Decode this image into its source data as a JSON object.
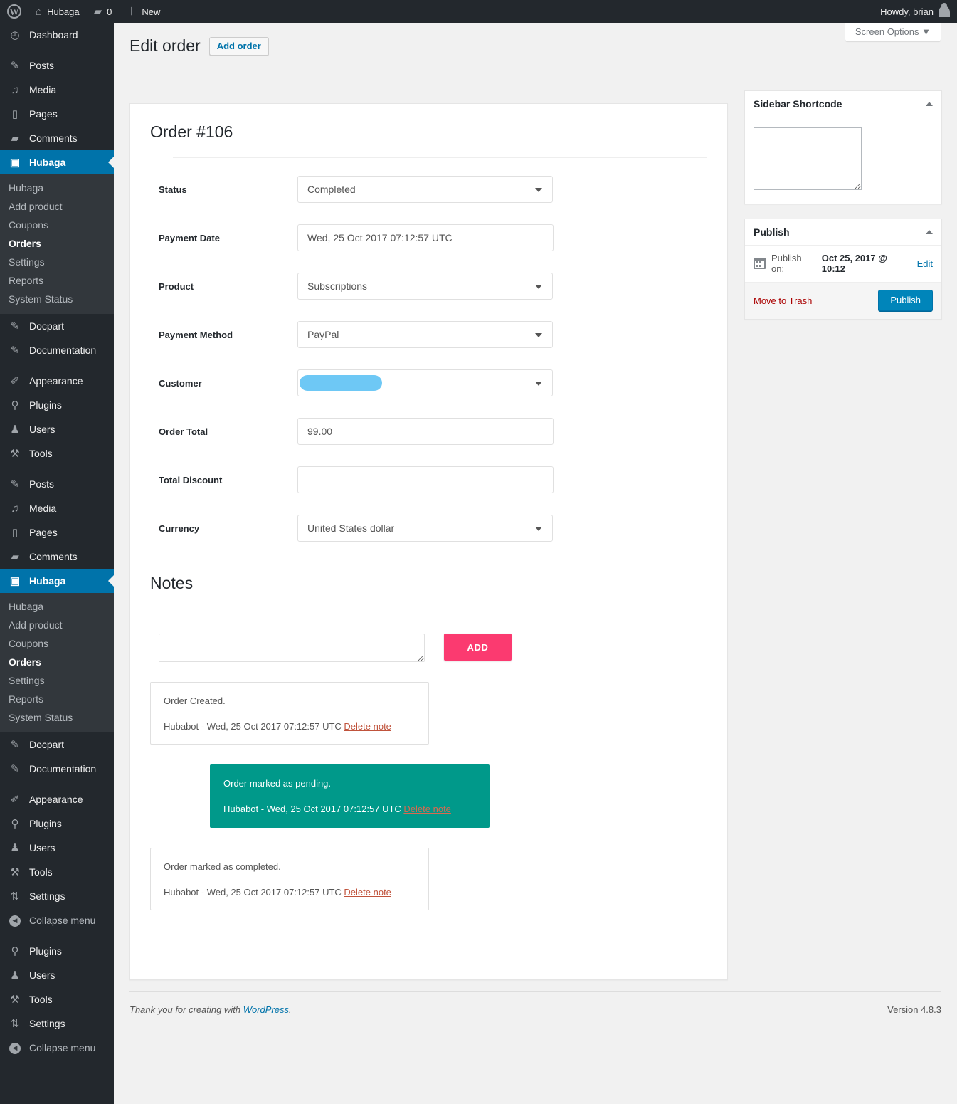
{
  "adminbar": {
    "logo_icon": "wordpress-logo",
    "site_name": "Hubaga",
    "site_icon": "home-icon",
    "comments_icon": "comment-bubble-icon",
    "comment_count": "0",
    "new_icon": "plus-icon",
    "new_label": "New",
    "howdy": "Howdy, brian",
    "avatar_icon": "user-avatar-icon"
  },
  "screen_meta": {
    "screen_options_label": "Screen Options",
    "caret_icon": "chevron-down-icon"
  },
  "header": {
    "title": "Edit order",
    "action_label": "Add order"
  },
  "sidebar": {
    "groups": [
      {
        "items": [
          {
            "label": "Dashboard",
            "icon": "dashboard-icon",
            "glyph": "◴",
            "current": false
          }
        ]
      },
      {
        "items": [
          {
            "label": "Posts",
            "icon": "pin-icon",
            "glyph": "✎",
            "current": false
          },
          {
            "label": "Media",
            "icon": "media-icon",
            "glyph": "♪",
            "current": false
          },
          {
            "label": "Pages",
            "icon": "page-icon",
            "glyph": "▮",
            "current": false
          },
          {
            "label": "Comments",
            "icon": "comment-bubble-icon",
            "glyph": "❝",
            "current": false
          },
          {
            "label": "Hubaga",
            "icon": "shopping-bag-icon",
            "glyph": "▢",
            "current": true
          }
        ]
      }
    ],
    "submenu": {
      "items": [
        {
          "label": "Hubaga",
          "current": false
        },
        {
          "label": "Add product",
          "current": false
        },
        {
          "label": "Coupons",
          "current": false
        },
        {
          "label": "Orders",
          "current": true
        },
        {
          "label": "Settings",
          "current": false
        },
        {
          "label": "Reports",
          "current": false
        },
        {
          "label": "System Status",
          "current": false
        }
      ]
    },
    "group_plugins": [
      {
        "label": "Docpart",
        "icon": "pin-icon",
        "glyph": "✎"
      },
      {
        "label": "Documentation",
        "icon": "pin-icon",
        "glyph": "✎"
      }
    ],
    "group_admin": [
      {
        "label": "Appearance",
        "icon": "paintbrush-icon",
        "glyph": "✐"
      },
      {
        "label": "Plugins",
        "icon": "plug-icon",
        "glyph": "⚯"
      },
      {
        "label": "Users",
        "icon": "user-icon",
        "glyph": "♟"
      },
      {
        "label": "Tools",
        "icon": "wrench-icon",
        "glyph": "⚒"
      }
    ],
    "group_admin_tail": [
      {
        "label": "Settings",
        "icon": "settings-sliders-icon",
        "glyph": "⇅"
      }
    ],
    "collapse_label": "Collapse menu",
    "collapse_icon": "collapse-arrow-icon"
  },
  "order": {
    "heading": "Order #106",
    "fields": [
      {
        "label": "Status",
        "type": "select",
        "value": "Completed",
        "name": "status"
      },
      {
        "label": "Payment Date",
        "type": "text",
        "value": "Wed, 25 Oct 2017 07:12:57 UTC",
        "name": "payment-date"
      },
      {
        "label": "Product",
        "type": "select",
        "value": "Subscriptions",
        "name": "product"
      },
      {
        "label": "Payment Method",
        "type": "select",
        "value": "PayPal",
        "name": "payment-method"
      },
      {
        "label": "Customer",
        "type": "select-redacted",
        "value": "",
        "name": "customer"
      },
      {
        "label": "Order Total",
        "type": "text",
        "value": "99.00",
        "name": "order-total"
      },
      {
        "label": "Total Discount",
        "type": "text",
        "value": "",
        "name": "total-discount"
      },
      {
        "label": "Currency",
        "type": "select",
        "value": "United States dollar",
        "name": "currency"
      }
    ]
  },
  "notes": {
    "heading": "Notes",
    "input_placeholder": "",
    "input_value": "",
    "add_label": "ADD",
    "delete_label": "Delete note",
    "items": [
      {
        "text": "Order Created.",
        "meta": "Hubabot - Wed, 25 Oct 2017 07:12:57 UTC",
        "delete_label": "Delete note",
        "style": "plain"
      },
      {
        "text": "Order marked as pending.",
        "meta": "Hubabot - Wed, 25 Oct 2017 07:12:57 UTC",
        "delete_label": "Delete note",
        "style": "teal"
      },
      {
        "text": "Order marked as completed.",
        "meta": "Hubabot - Wed, 25 Oct 2017 07:12:57 UTC",
        "delete_label": "Delete note",
        "style": "plain"
      }
    ]
  },
  "side": {
    "shortcode_panel": {
      "title": "Sidebar Shortcode",
      "textarea_value": "",
      "toggle_icon": "chevron-up-icon"
    },
    "publish_panel": {
      "title": "Publish",
      "toggle_icon": "chevron-up-icon",
      "calendar_icon": "calendar-icon",
      "publish_on_prefix": "Publish on:",
      "publish_on_date": "Oct 25, 2017 @ 10:12",
      "edit_label": "Edit",
      "trash_label": "Move to Trash",
      "publish_label": "Publish"
    }
  },
  "footer": {
    "thanks_prefix": "Thank you for creating with",
    "wordpress_label": "WordPress",
    "thanks_suffix": ".",
    "version": "Version 4.8.3"
  },
  "colors": {
    "admin_bg": "#23282d",
    "submenu_bg": "#32373c",
    "accent_blue": "#0073aa",
    "publish_blue": "#0085ba",
    "add_pink": "#fb3a70",
    "note_teal": "#00998a",
    "redaction_blue": "#6ec8f5",
    "link_red": "#a00"
  }
}
